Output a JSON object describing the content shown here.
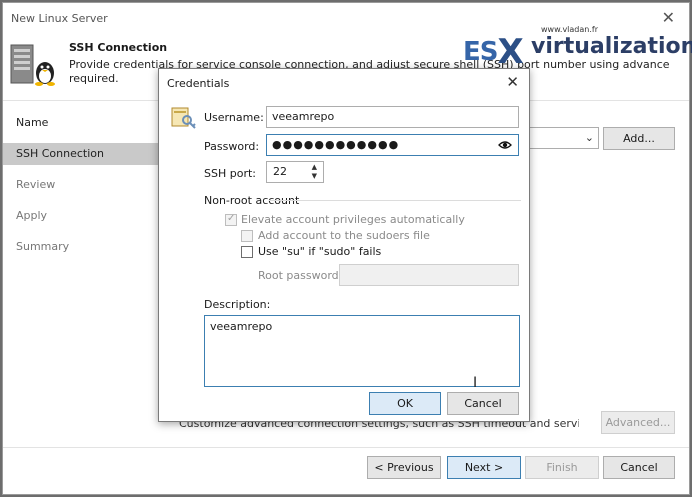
{
  "window": {
    "title": "New Linux Server"
  },
  "header": {
    "title": "SSH Connection",
    "description_line1": "Provide credentials for service console connection, and adjust secure shell (SSH) port number using advanced settings if",
    "description_line2": "required."
  },
  "watermark": {
    "es": "ES",
    "x": "X",
    "virtualization": "virtualization",
    "site": "www.vladan.fr"
  },
  "sidebar": {
    "items": [
      {
        "label": "Name"
      },
      {
        "label": "SSH Connection"
      },
      {
        "label": "Review"
      },
      {
        "label": "Apply"
      },
      {
        "label": "Summary"
      }
    ]
  },
  "main": {
    "add_button": "Add...",
    "advanced_text": "Customize advanced connection settings, such as SSH timeout and service ports.",
    "advanced_button": "Advanced..."
  },
  "footer": {
    "previous": "< Previous",
    "next": "Next >",
    "finish": "Finish",
    "cancel": "Cancel"
  },
  "dialog": {
    "title": "Credentials",
    "username_label": "Username:",
    "username_value": "veeamrepo",
    "password_label": "Password:",
    "password_masked": "●●●●●●●●●●●●",
    "ssh_port_label": "SSH port:",
    "ssh_port_value": "22",
    "nonroot_section": "Non-root account",
    "elevate_label": "Elevate account privileges automatically",
    "add_sudoers_label": "Add account to the sudoers file",
    "use_su_label": "Use \"su\" if \"sudo\" fails",
    "root_password_label": "Root password:",
    "description_label": "Description:",
    "description_value": "veeamrepo",
    "ok_button": "OK",
    "cancel_button": "Cancel"
  },
  "colors": {
    "accent_blue": "#3c7fb1",
    "watermark_blue": "#3565a8",
    "active_step": "#c9c9c9"
  }
}
